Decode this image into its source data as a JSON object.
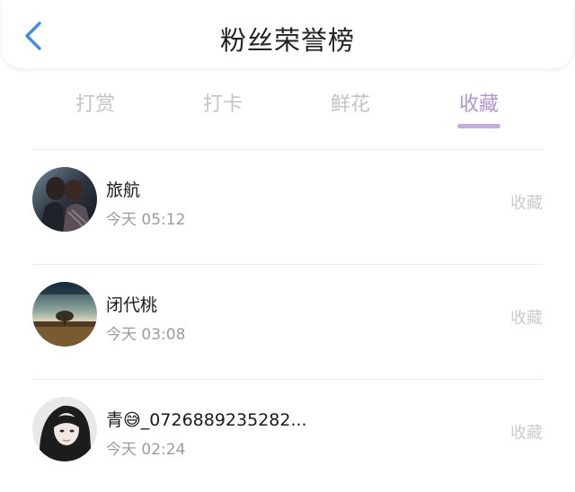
{
  "header": {
    "title": "粉丝荣誉榜",
    "back_icon": "chevron-left-icon",
    "back_color": "#3d8ee8"
  },
  "tabs": [
    {
      "label": "打赏",
      "active": false
    },
    {
      "label": "打卡",
      "active": false
    },
    {
      "label": "鲜花",
      "active": false
    },
    {
      "label": "收藏",
      "active": true
    }
  ],
  "accent_color": "#c5a9e3",
  "fans": [
    {
      "name": "旅航",
      "time": "今天 05:12",
      "action": "收藏",
      "avatar": "couple-photo-avatar"
    },
    {
      "name": "闭代桃",
      "time": "今天 03:08",
      "action": "收藏",
      "avatar": "landscape-tree-avatar"
    },
    {
      "name": "青😅_0726889235282...",
      "time": "今天 02:24",
      "action": "收藏",
      "avatar": "girl-portrait-avatar"
    }
  ]
}
